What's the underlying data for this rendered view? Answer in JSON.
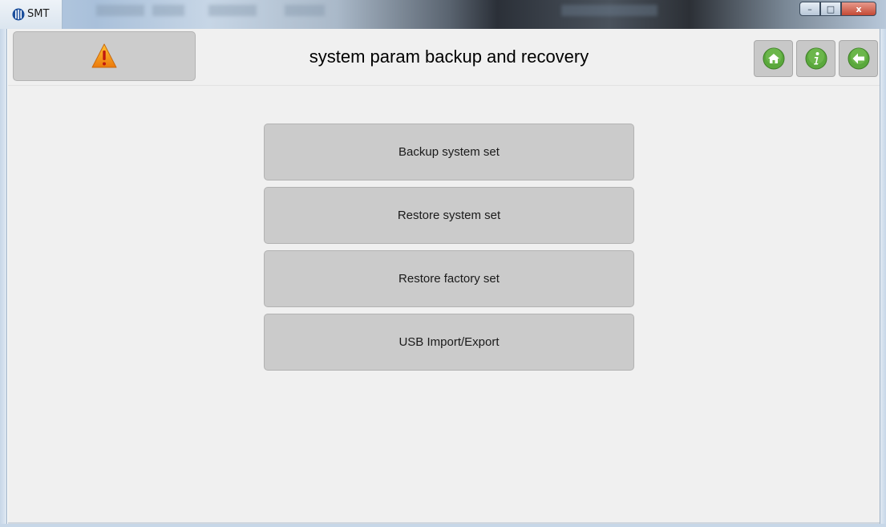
{
  "window": {
    "app_title": "SMT",
    "controls": {
      "minimize": "–",
      "maximize": "□",
      "close": "x"
    }
  },
  "header": {
    "alarm_icon": "warning-triangle-icon",
    "title": "system param backup and recovery",
    "nav": [
      {
        "icon": "home-icon"
      },
      {
        "icon": "info-icon"
      },
      {
        "icon": "back-arrow-icon"
      }
    ]
  },
  "menu": {
    "items": [
      {
        "label": "Backup system set"
      },
      {
        "label": "Restore system set"
      },
      {
        "label": "Restore factory set"
      },
      {
        "label": "USB Import/Export"
      }
    ]
  },
  "colors": {
    "background": "#f0f0f0",
    "button_gray": "#cbcbcb",
    "icon_green": "#5aa83c",
    "warning_orange": "#f29a1e"
  }
}
